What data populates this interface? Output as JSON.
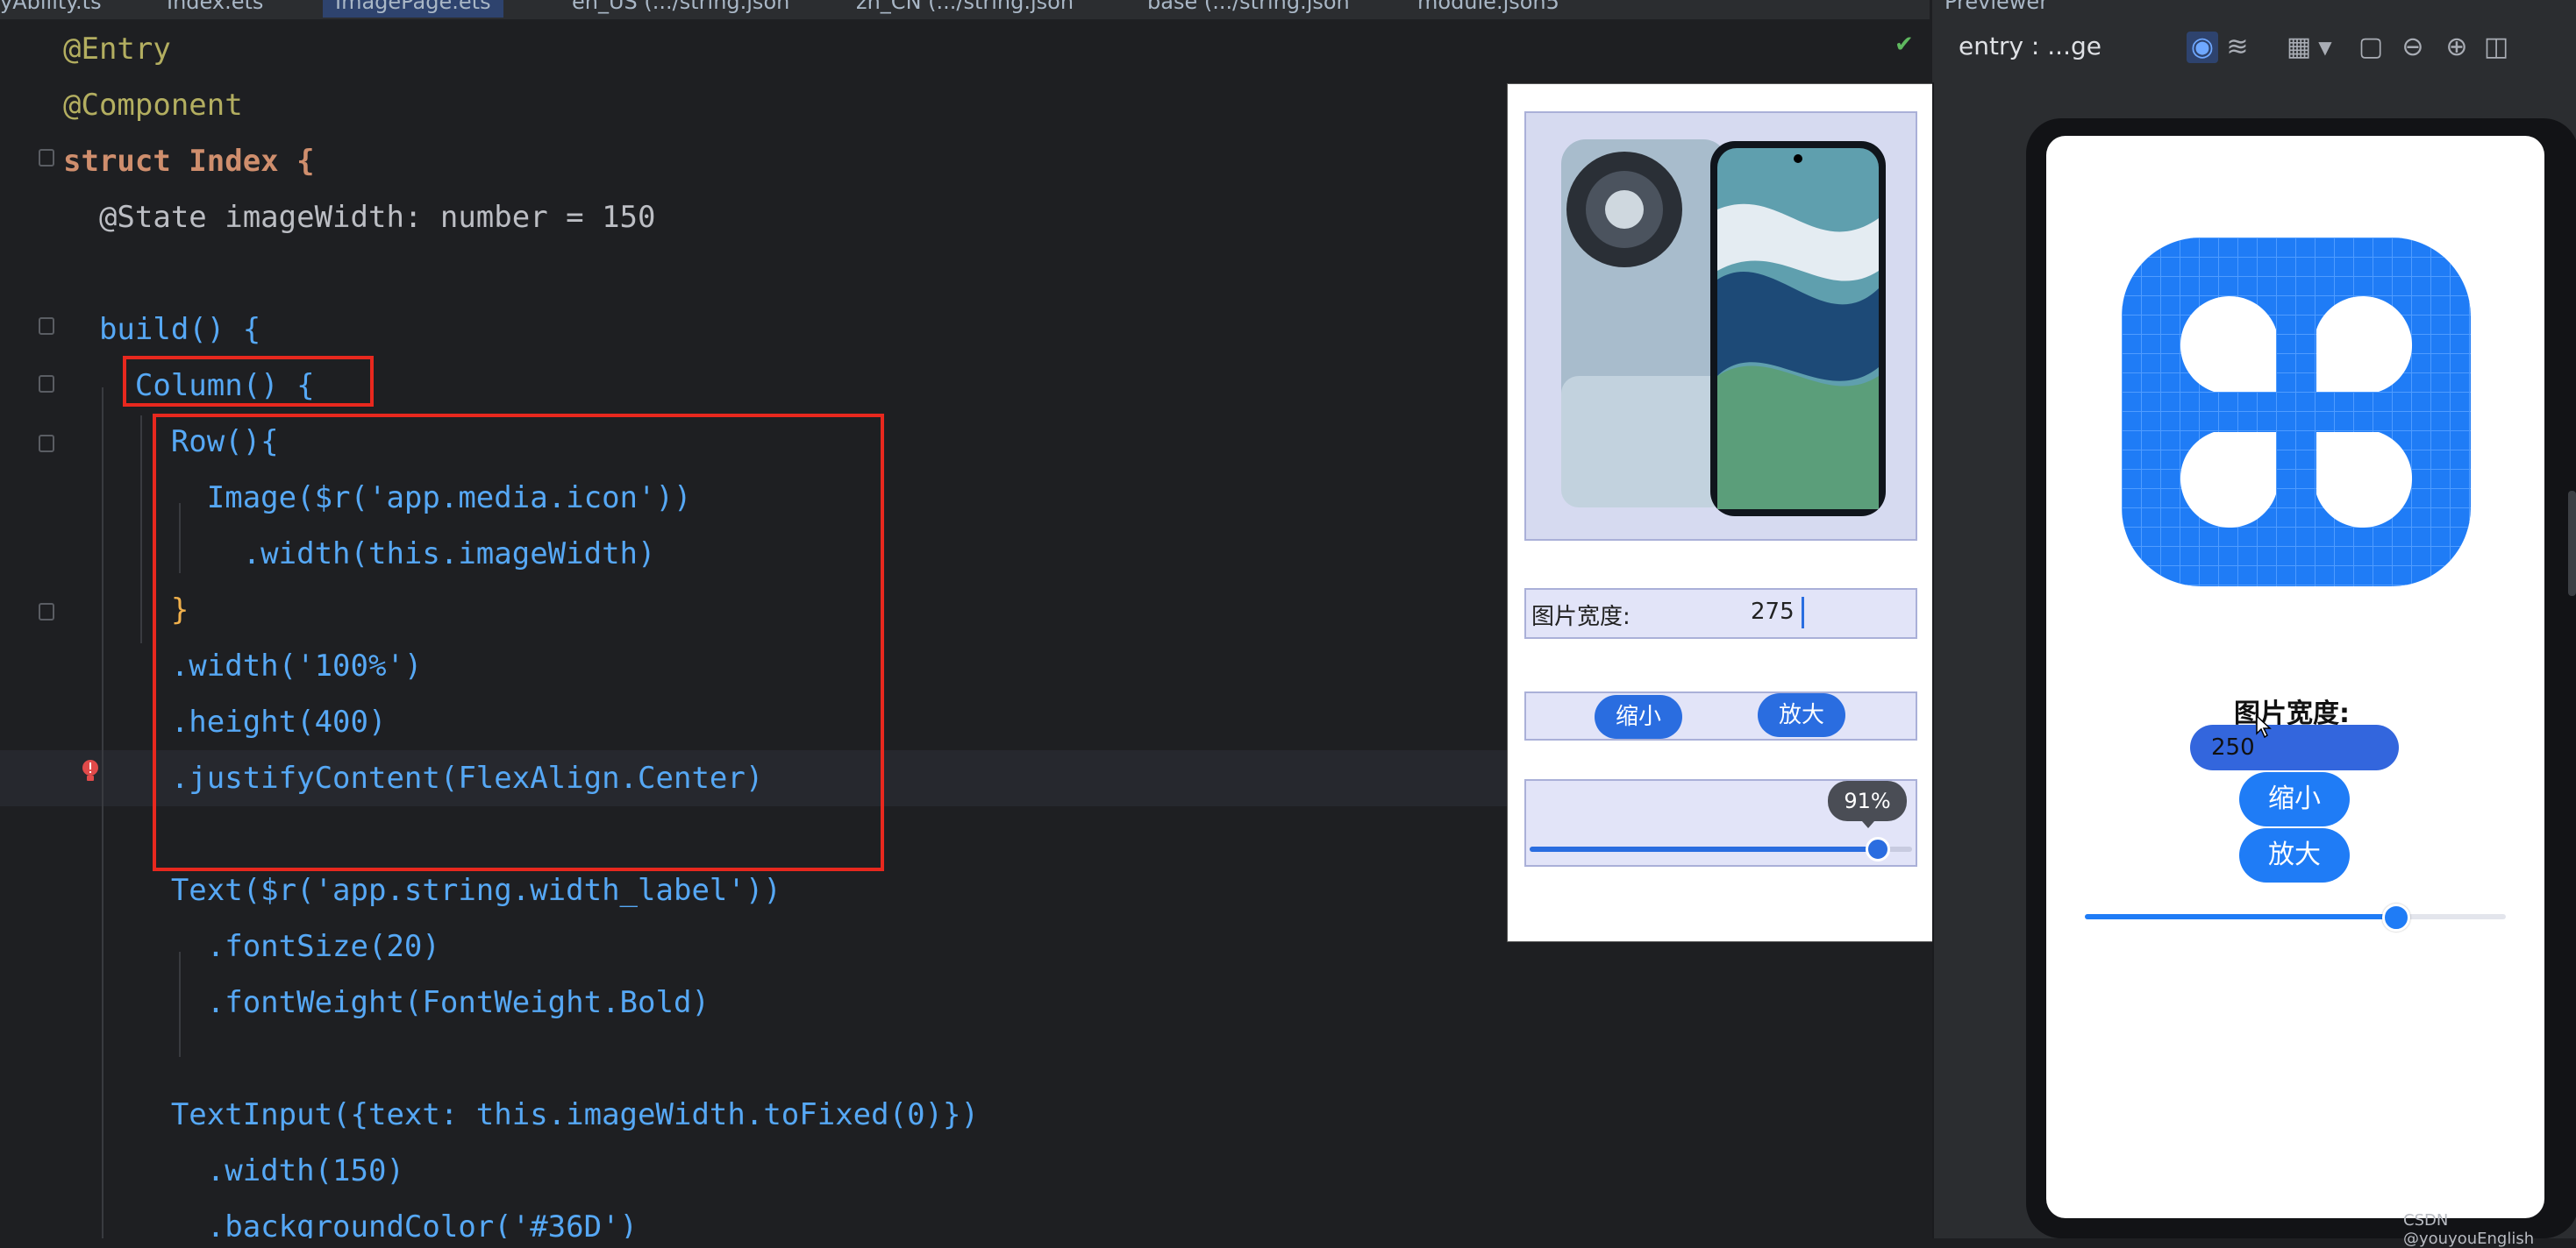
{
  "tabs": [
    "yAbility.ts",
    "Index.ets",
    "ImagePage.ets",
    "en_US (.../string.json",
    "zh_CN (.../string.json",
    "base (.../string.json",
    "module.json5"
  ],
  "code": {
    "lines": [
      "@Entry",
      "@Component",
      "struct Index {",
      "  @State imageWidth: number = 150",
      "",
      "  build() {",
      "    Column() {",
      "      Row(){",
      "        Image($r('app.media.icon'))",
      "          .width(this.imageWidth)",
      "      }",
      "      .width('100%')",
      "      .height(400)",
      "      .justifyContent(FlexAlign.Center)",
      "",
      "      Text($r('app.string.width_label'))",
      "        .fontSize(20)",
      "        .fontWeight(FontWeight.Bold)",
      "",
      "      TextInput({text: this.imageWidth.toFixed(0)})",
      "        .width(150)",
      "        .backgroundColor('#36D')"
    ]
  },
  "inline_preview": {
    "width_label": "图片宽度:",
    "width_value": "275",
    "shrink_button": "缩小",
    "enlarge_button": "放大",
    "slider_tooltip": "91%",
    "slider_value": 0.91
  },
  "previewer": {
    "panel_title": "Previewer",
    "device_label": "entry : ...ge",
    "width_label": "图片宽度:",
    "input_value": "250",
    "shrink_button": "缩小",
    "enlarge_button": "放大",
    "slider_value": 0.74
  },
  "watermark": "CSDN @youyouEnglish",
  "colors": {
    "accent_blue": "#2a6de0",
    "highlight_red": "#e8281e",
    "app_icon_blue": "#1f7cf6",
    "input_blue": "#3366dd"
  }
}
